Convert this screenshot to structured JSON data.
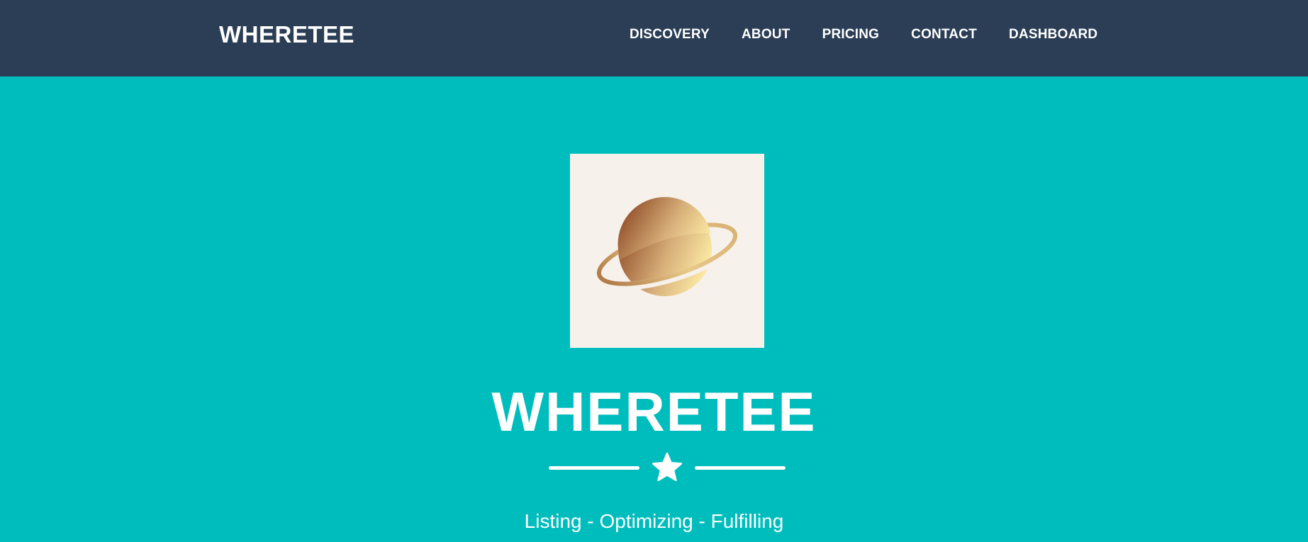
{
  "navbar": {
    "brand": "WHERETEE",
    "items": [
      {
        "label": "DISCOVERY"
      },
      {
        "label": "ABOUT"
      },
      {
        "label": "PRICING"
      },
      {
        "label": "CONTACT"
      },
      {
        "label": "DASHBOARD"
      }
    ]
  },
  "hero": {
    "title": "WHERETEE",
    "subtitle": "Listing - Optimizing - Fulfilling",
    "divider_icon": "star-icon",
    "logo_icon": "planet-icon"
  },
  "colors": {
    "navbar_bg": "#2B3E55",
    "hero_bg": "#00BDBD",
    "text": "#FFFFFF",
    "logo_bg": "#F6F1EB",
    "planet_dark": "#8E4A26",
    "planet_light": "#FFF0A8"
  }
}
